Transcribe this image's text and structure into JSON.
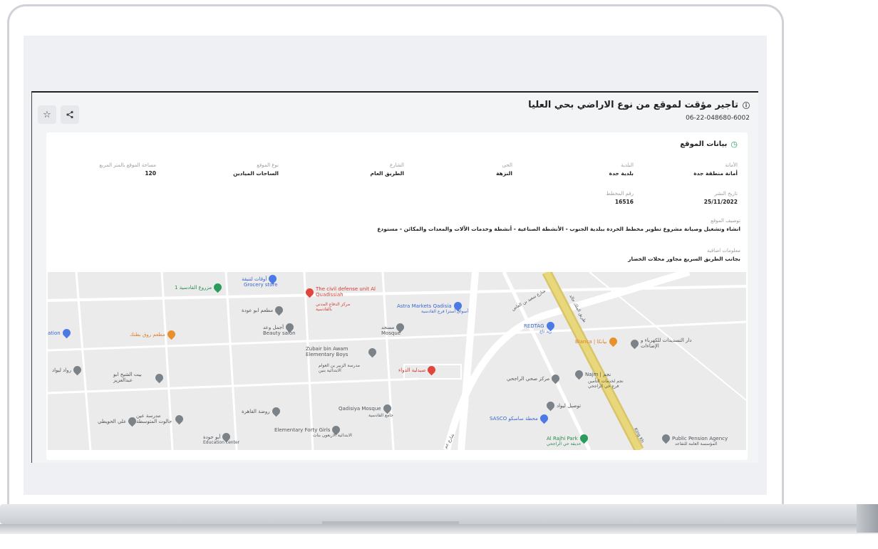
{
  "header": {
    "title": "تاجير مؤقت لموقع من نوع الاراضي بحي العليا",
    "reference_code": "06-22-048680-6002",
    "share_icon": "share-icon",
    "favorite_icon": "star-icon"
  },
  "section": {
    "title": "بيانات الموقع",
    "icon": "clock-icon"
  },
  "fields": {
    "amanah_label": "الأمانة",
    "amanah_value": "أمانة منطقة جدة",
    "municipality_label": "البلدية",
    "municipality_value": "بلدية جدة",
    "district_label": "الحي",
    "district_value": "النزهة",
    "street_label": "الشارع",
    "street_value": "الطريق العام",
    "site_type_label": "نوع الموقع",
    "site_type_value": "الساحات الميادين",
    "area_label": "مساحة الموقع بالمتر المربع",
    "area_value": "120",
    "publish_date_label": "تاريخ النشر",
    "publish_date_value": "25/11/2022",
    "plan_number_label": "رقم المخطط",
    "plan_number_value": "16516",
    "description_label": "توصيف الموقع",
    "description_value": "انشاء وتشغيل وصيانة مشروع تطوير مخطط الخردة ببلدية الجنوب - الأنشطة الصناعية - أنشطة وخدمات الآلات والمعدات والمكائن - مستودع",
    "extra_label": "معلومات اضافية",
    "extra_value": "بجانب الطريق السريع مجاور محلات الخضار"
  },
  "map": {
    "pois": [
      {
        "name": "أوقات لتنيقة",
        "sub": "Grocery store",
        "color": "blue"
      },
      {
        "name": "مزروع القادسية 1",
        "color": "green"
      },
      {
        "name": "The civil defense unit Al Quadissiah",
        "sub": "مركز الدفاع المدني بالقادسية",
        "color": "red"
      },
      {
        "name": "Astra Markets Qadisia",
        "sub": "أسواق أسترا فرع القادسية",
        "color": "blue"
      },
      {
        "name": "مطعم ابو عودة",
        "color": "gray"
      },
      {
        "name": "أجمل وعد",
        "sub": "Beauty salon",
        "color": "gray"
      },
      {
        "name": "مسجد",
        "sub": "Mosque",
        "color": "gray"
      },
      {
        "name": "REDTAG",
        "sub": "ريد تاج",
        "color": "blue"
      },
      {
        "name": "ation",
        "color": "blue"
      },
      {
        "name": "مطعم روق بطنك",
        "color": "orange"
      },
      {
        "name": "Zubair bin Awam Elementary Boys",
        "sub": "مدرسة الزبير بن العوام الابتدائية بنين",
        "color": "gray"
      },
      {
        "name": "Bianca | بيانكا",
        "color": "orange"
      },
      {
        "name": "دار التسديدات للكهرباء و الإضاءات",
        "color": "gray"
      },
      {
        "name": "صيدلية الدواء",
        "color": "red"
      },
      {
        "name": "رواد ليواد",
        "color": "gray"
      },
      {
        "name": "بيت الشيخ ابو عبدالعزيز",
        "color": "gray"
      },
      {
        "name": "مركز صحي الراجحي",
        "color": "gray"
      },
      {
        "name": "Najm | نجم",
        "sub": "نجم لخدمات التأمين فرع حي الراجحي",
        "color": "gray"
      },
      {
        "name": "روضة القاهرة",
        "color": "gray"
      },
      {
        "name": "Qadisiya Mosque",
        "sub": "جامع القادسية",
        "color": "gray"
      },
      {
        "name": "توصيل ليواد",
        "color": "gray"
      },
      {
        "name": "مدرسة عين جالوت المتوسطة",
        "color": "gray"
      },
      {
        "name": "علي الحويطي",
        "color": "gray"
      },
      {
        "name": "SASCO محطة ساسكو",
        "color": "blue"
      },
      {
        "name": "Elementary Forty Girls",
        "sub": "الابتدائية الاربعون بنات",
        "color": "gray"
      },
      {
        "name": "أبو جودة",
        "sub": "Education center",
        "color": "gray"
      },
      {
        "name": "Al Rajhi Park",
        "sub": "حديقة حي الراجحي",
        "color": "green"
      },
      {
        "name": "Public Pension Agency",
        "sub": "المؤسسة العامة للتقاعد",
        "color": "gray"
      }
    ],
    "road_labels": [
      "طريق الملك خالد",
      "شارع سعيد بن العاص",
      "King Kh",
      "شارع عم"
    ]
  }
}
